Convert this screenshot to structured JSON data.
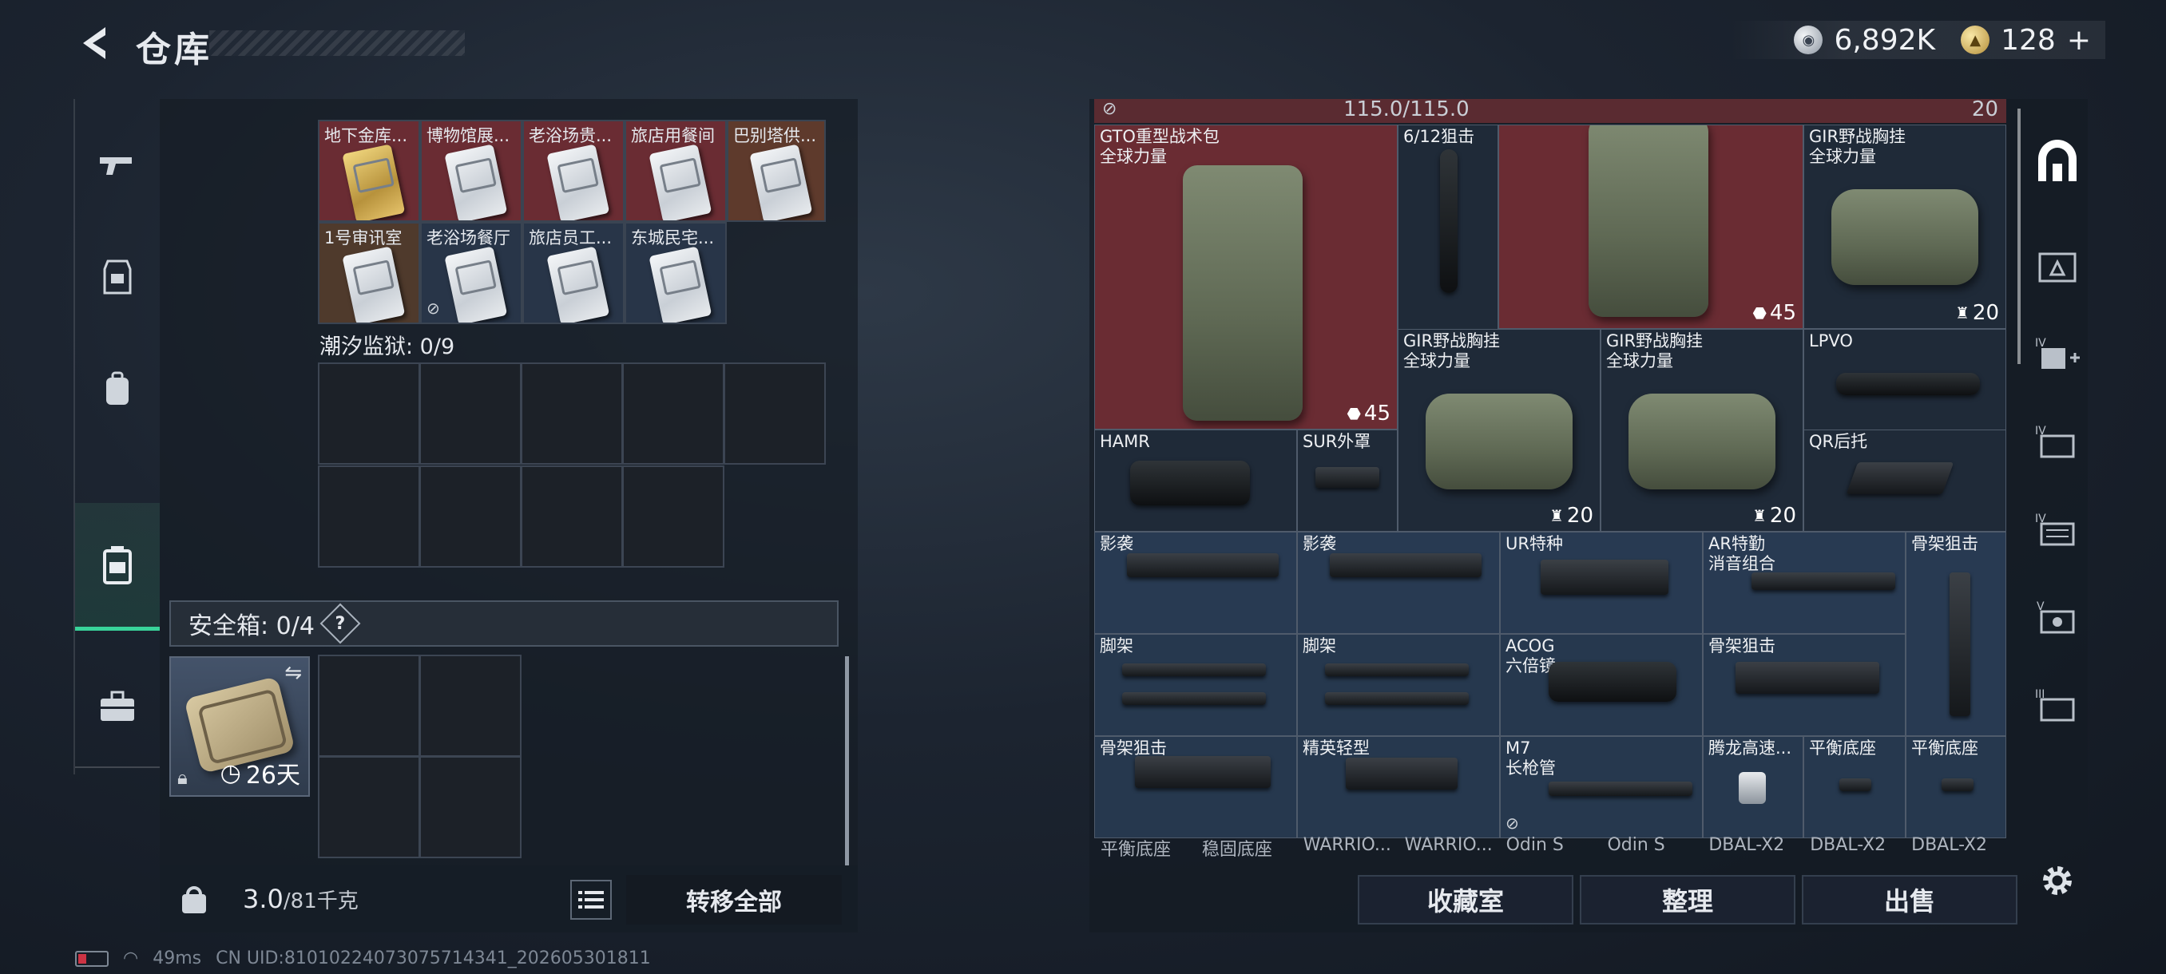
{
  "header": {
    "title": "仓库",
    "back_icon": "back-arrow-icon"
  },
  "currency": [
    {
      "icon": "silver-coin-icon",
      "value": "6,892K"
    },
    {
      "icon": "gold-coin-icon",
      "value": "128",
      "add": "+"
    }
  ],
  "left_rail": [
    "rifle-icon",
    "armor-icon",
    "backpack-icon",
    "container-icon",
    "toolbox-icon"
  ],
  "containers": {
    "top_row_labels": [
      "地下金库...",
      "博物馆展...",
      "老浴场贵...",
      "旅店用餐间",
      "巴别塔供..."
    ],
    "second_row_labels": [
      "1号审讯室",
      "老浴场餐厅",
      "旅店员工...",
      "东城民宅..."
    ],
    "prison_label": "潮汐监狱: 0/9",
    "safebox_label": "安全箱: 0/4",
    "safebox_help": "?",
    "safebox_days": "26天"
  },
  "footer_left": {
    "weight_value": "3.0",
    "weight_max": "/81千克",
    "transfer_all": "转移全部"
  },
  "stash": {
    "capacity": "115.0/115.0",
    "items": {
      "gto_bag": {
        "label": "GTO重型战术包\n全球力量",
        "count": "45"
      },
      "scope_612": {
        "label": "6/12狙击"
      },
      "bag2": {
        "count": "45"
      },
      "gir1": {
        "label": "GIR野战胸挂\n全球力量",
        "count": "20"
      },
      "gir2": {
        "label": "GIR野战胸挂\n全球力量",
        "count": "20"
      },
      "gir3": {
        "label": "GIR野战胸挂\n全球力量",
        "count": "20"
      },
      "lpvo": {
        "label": "LPVO"
      },
      "hamr": {
        "label": "HAMR"
      },
      "sur": {
        "label": "SUR外罩"
      },
      "qr": {
        "label": "QR后托"
      },
      "yingxi1": {
        "label": "影袭"
      },
      "yingxi2": {
        "label": "影袭"
      },
      "ur": {
        "label": "UR特种"
      },
      "ar": {
        "label": "AR特勤\n消音组合"
      },
      "guji1": {
        "label": "骨架狙击"
      },
      "jiaojia1": {
        "label": "脚架"
      },
      "jiaojia2": {
        "label": "脚架"
      },
      "acog": {
        "label": "ACOG\n六倍镜"
      },
      "guji2": {
        "label": "骨架狙击"
      },
      "guji3": {
        "label": "骨架狙击"
      },
      "jingying": {
        "label": "精英轻型"
      },
      "m7": {
        "label": "M7\n长枪管"
      },
      "tenglong": {
        "label": "腾龙高速..."
      },
      "pingheng1": {
        "label": "平衡底座"
      },
      "pingheng2": {
        "label": "平衡底座"
      }
    },
    "bottom_row": [
      "平衡底座",
      "稳固底座",
      "WARRIO...",
      "WARRIO...",
      "Odin S",
      "Odin S",
      "DBAL-X2",
      "DBAL-X2",
      "DBAL-X2"
    ],
    "top_right_count": "20"
  },
  "actions": {
    "collection": "收藏室",
    "sort": "整理",
    "sell": "出售"
  },
  "right_rail": [
    "stash-home-icon",
    "tier-iii-sell-icon",
    "tier-iv-add-icon",
    "tier-iv-folder-icon",
    "tier-iv-list-icon",
    "tier-v-icon",
    "tier-iii-icon"
  ],
  "status_bar": {
    "ping": "49ms",
    "uid": "CN UID:8101022407307571434​1_202605301811"
  },
  "colors": {
    "accent_green": "#39d39a",
    "stash_red": "#6a2c33",
    "stash_blue": "#283a52"
  }
}
